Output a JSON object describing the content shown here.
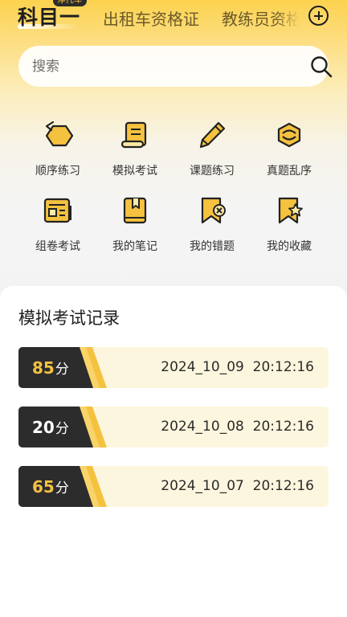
{
  "tabs": {
    "active": "科目一",
    "active_badge": "摩托车",
    "items": [
      "出租车资格证",
      "教练员资格证"
    ]
  },
  "search": {
    "placeholder": "搜索"
  },
  "grid": [
    {
      "label": "顺序练习",
      "icon": "hexagon-arrow-icon"
    },
    {
      "label": "模拟考试",
      "icon": "scroll-icon"
    },
    {
      "label": "课题练习",
      "icon": "pencil-icon"
    },
    {
      "label": "真题乱序",
      "icon": "shuffle-icon"
    },
    {
      "label": "组卷考试",
      "icon": "newspaper-icon"
    },
    {
      "label": "我的笔记",
      "icon": "book-icon"
    },
    {
      "label": "我的错题",
      "icon": "bookmark-x-icon"
    },
    {
      "label": "我的收藏",
      "icon": "bookmark-star-icon"
    }
  ],
  "records": {
    "title": "模拟考试记录",
    "unit": "分",
    "items": [
      {
        "score": "85",
        "date": "2024_10_09",
        "time": "20:12:16",
        "score_color": "#f5c240"
      },
      {
        "score": "20",
        "date": "2024_10_08",
        "time": "20:12:16",
        "score_color": "#ffffff"
      },
      {
        "score": "65",
        "date": "2024_10_07",
        "time": "20:12:16",
        "score_color": "#f5c240"
      }
    ]
  },
  "colors": {
    "accent": "#f5c240",
    "dark": "#2c2c2c"
  }
}
